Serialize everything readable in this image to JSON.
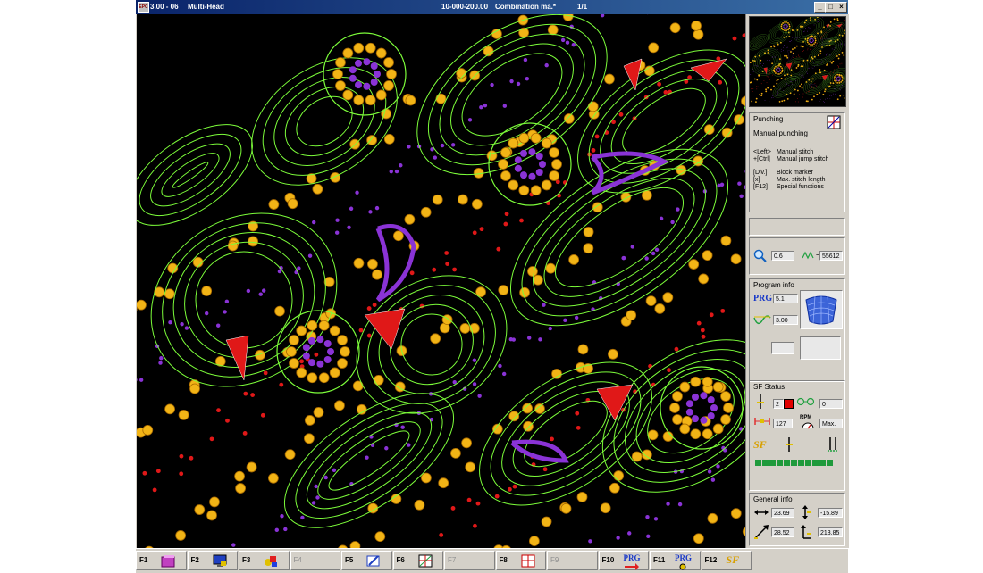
{
  "titlebar": {
    "app": "3.00 - 06",
    "mode": "Multi-Head",
    "file": "10-000-200.00",
    "combo": "Combination ma.*",
    "page": "1/1",
    "logo": "EPC"
  },
  "window_buttons": {
    "minimize": "_",
    "restore": "□",
    "close": "×"
  },
  "punching": {
    "title": "Punching",
    "subtitle": "Manual punching",
    "shortcuts": [
      {
        "key": "<Left>",
        "desc": "Manual stitch"
      },
      {
        "key": "+[Ctrl]",
        "desc": "Manual jump stitch"
      },
      {
        "key": "[Div.]",
        "desc": "Block marker"
      },
      {
        "key": "[x]",
        "desc": "Max. stitch length"
      },
      {
        "key": "[F12]",
        "desc": "Special functions"
      }
    ]
  },
  "zoom": {
    "value": "0.6",
    "stitch_count": "55612",
    "stitch_prefix": "="
  },
  "program_info": {
    "title": "Program info",
    "prg_label": "PRG",
    "prg_value": "5.1",
    "speed_value": "3.00"
  },
  "sf_status": {
    "title": "SF Status",
    "needle": "2",
    "needle_color": "#e00000",
    "count": "0",
    "stitch_len": "127",
    "rpm_label": "RPM",
    "rpm_value": "Max.",
    "sf_label": "SF",
    "progress": 11
  },
  "general_info": {
    "title": "General info",
    "width": "23.69",
    "height": "-15.89",
    "diag": "28.52",
    "v2": "213.85"
  },
  "fkeys": [
    {
      "label": "F1",
      "icon": "book-icon",
      "enabled": true
    },
    {
      "label": "F2",
      "icon": "monitor-icon",
      "enabled": true
    },
    {
      "label": "F3",
      "icon": "shapes-icon",
      "enabled": true
    },
    {
      "label": "F4",
      "icon": "",
      "enabled": false
    },
    {
      "label": "F5",
      "icon": "edit-icon",
      "enabled": true
    },
    {
      "label": "F6",
      "icon": "grid-icon",
      "enabled": true
    },
    {
      "label": "F7",
      "icon": "",
      "enabled": false
    },
    {
      "label": "F8",
      "icon": "frame-icon",
      "enabled": true
    },
    {
      "label": "F9",
      "icon": "",
      "enabled": false
    },
    {
      "label": "F10",
      "icon": "prg-arrow-icon",
      "enabled": true,
      "text": "PRG"
    },
    {
      "label": "F11",
      "icon": "prg-tool-icon",
      "enabled": true,
      "text": "PRG"
    },
    {
      "label": "F12",
      "icon": "sf-icon",
      "enabled": true,
      "text": "SF"
    }
  ],
  "colors": {
    "canvas_bg": "#000000",
    "outline_green": "#7CFC3A",
    "dot_yellow": "#F2B416",
    "dot_purple": "#8A33D6",
    "dot_red": "#E01818"
  }
}
